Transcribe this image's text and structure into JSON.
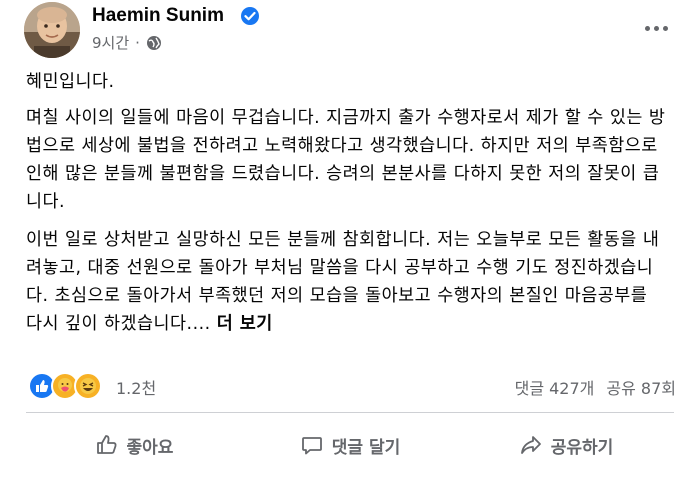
{
  "post": {
    "author": "Haemin Sunim",
    "time": "9시간",
    "privacy_icon": "globe-icon",
    "paragraphs": [
      "혜민입니다.",
      "며칠 사이의 일들에 마음이 무겁습니다. 지금까지 출가 수행자로서 제가 할 수 있는 방법으로 세상에 불법을 전하려고 노력해왔다고 생각했습니다. 하지만 저의 부족함으로 인해 많은 분들께 불편함을 드렸습니다. 승려의 본분사를 다하지 못한 저의 잘못이 큽니다.",
      "이번 일로 상처받고 실망하신 모든 분들께 참회합니다. 저는 오늘부로 모든 활동을 내려놓고, 대중 선원으로 돌아가 부처님 말씀을 다시 공부하고 수행 기도 정진하겠습니다. 초심으로 돌아가서 부족했던 저의 모습을 돌아보고 수행자의 본질인 마음공부를 다시 깊이 하겠습니다...."
    ],
    "see_more": "더 보기"
  },
  "stats": {
    "reaction_count": "1.2천",
    "comments": "댓글 427개",
    "shares": "공유 87회",
    "reactions": [
      "like",
      "care",
      "haha"
    ]
  },
  "actions": {
    "like": "좋아요",
    "comment": "댓글 달기",
    "share": "공유하기"
  },
  "colors": {
    "accent": "#1877f2",
    "secondary_text": "#65676b",
    "divider": "#ced0d4"
  }
}
